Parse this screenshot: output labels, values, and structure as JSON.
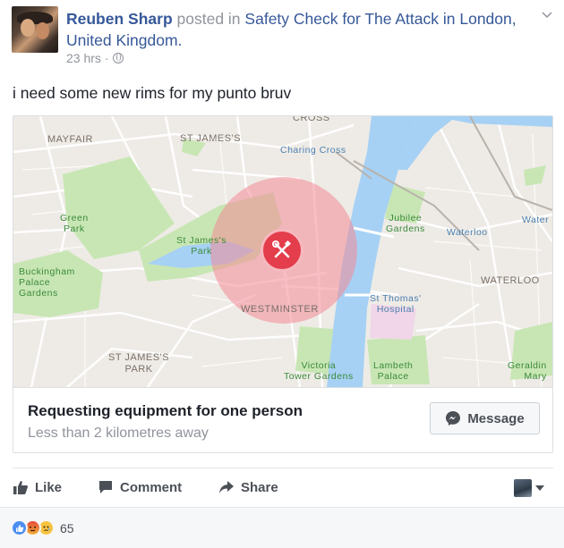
{
  "post": {
    "author": "Reuben Sharp",
    "posted_in": "posted in",
    "page": "Safety Check for The Attack in London, United Kingdom.",
    "time": "23 hrs",
    "separator": "·",
    "text": "i need some new rims for my punto bruv"
  },
  "map": {
    "labels": {
      "cross_top": "CROSS",
      "mayfair": "MAYFAIR",
      "st_james": "ST JAMES'S",
      "charing_cross": "Charing Cross",
      "green_park": "Green\nPark",
      "st_james_park": "St James's\nPark",
      "jubilee_gardens": "Jubilee\nGardens",
      "waterloo": "Waterloo",
      "water": "Water",
      "buckingham": "Buckingham\nPalace\nGardens",
      "westminster": "WESTMINSTER",
      "waterloo_area": "WATERLOO",
      "st_thomas": "St Thomas'\nHospital",
      "st_james_park_area": "ST JAMES'S\nPARK",
      "victoria_tower": "Victoria\nTower Gardens",
      "lambeth_palace": "Lambeth\nPalace",
      "geraldine_mary": "Geraldin\nMary"
    },
    "colors": {
      "land": "#eeebe6",
      "park": "#c8e6b4",
      "water": "#a6d1f4",
      "circle": "#f28a95"
    }
  },
  "attachment": {
    "title": "Requesting equipment for one person",
    "subtitle": "Less than 2 kilometres away",
    "message_label": "Message"
  },
  "actions": {
    "like": "Like",
    "comment": "Comment",
    "share": "Share"
  },
  "reactions": {
    "count": "65",
    "types": [
      "like",
      "angry",
      "sad"
    ]
  }
}
